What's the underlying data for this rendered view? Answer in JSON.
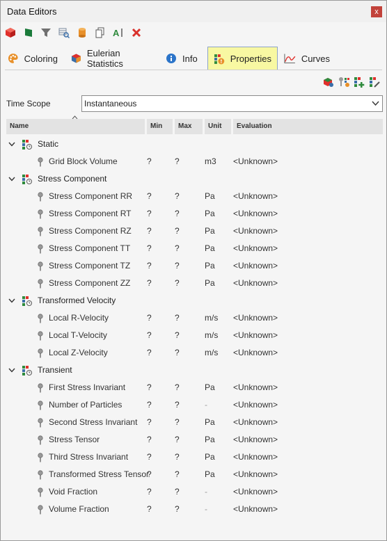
{
  "window": {
    "title": "Data Editors",
    "close_glyph": "x"
  },
  "toolbar": [
    {
      "name": "red-cube-icon",
      "color": "#e0302c"
    },
    {
      "name": "green-flag-icon",
      "color": "#1a7a3a"
    },
    {
      "name": "filter-icon",
      "color": "#707070"
    },
    {
      "name": "search-grid-icon",
      "color": "#5a7fa8"
    },
    {
      "name": "cylinder-icon",
      "color": "#e8902a"
    },
    {
      "name": "copy-icon",
      "color": "#555555"
    },
    {
      "name": "text-cursor-icon",
      "color": "#2e8a3c"
    },
    {
      "name": "delete-icon",
      "color": "#d9312b"
    }
  ],
  "tabs": [
    {
      "label": "Coloring",
      "icon": "palette-icon",
      "active": false
    },
    {
      "label": "Eulerian Statistics",
      "icon": "statistics-cube-icon",
      "active": false
    },
    {
      "label": "Info",
      "icon": "info-icon",
      "active": false
    },
    {
      "label": "Properties",
      "icon": "properties-icon",
      "active": true
    },
    {
      "label": "Curves",
      "icon": "curve-chart-icon",
      "active": false
    }
  ],
  "time_scope": {
    "label": "Time Scope",
    "value": "Instantaneous"
  },
  "columns": {
    "name": "Name",
    "min": "Min",
    "max": "Max",
    "unit": "Unit",
    "evaluation": "Evaluation"
  },
  "groups": [
    {
      "label": "Static",
      "rows": [
        {
          "name": "Grid Block Volume",
          "min": "?",
          "max": "?",
          "unit": "m3",
          "evaluation": "<Unknown>"
        }
      ]
    },
    {
      "label": "Stress Component",
      "rows": [
        {
          "name": "Stress Component RR",
          "min": "?",
          "max": "?",
          "unit": "Pa",
          "evaluation": "<Unknown>"
        },
        {
          "name": "Stress Component RT",
          "min": "?",
          "max": "?",
          "unit": "Pa",
          "evaluation": "<Unknown>"
        },
        {
          "name": "Stress Component RZ",
          "min": "?",
          "max": "?",
          "unit": "Pa",
          "evaluation": "<Unknown>"
        },
        {
          "name": "Stress Component TT",
          "min": "?",
          "max": "?",
          "unit": "Pa",
          "evaluation": "<Unknown>"
        },
        {
          "name": "Stress Component TZ",
          "min": "?",
          "max": "?",
          "unit": "Pa",
          "evaluation": "<Unknown>"
        },
        {
          "name": "Stress Component ZZ",
          "min": "?",
          "max": "?",
          "unit": "Pa",
          "evaluation": "<Unknown>"
        }
      ]
    },
    {
      "label": "Transformed Velocity",
      "rows": [
        {
          "name": "Local R-Velocity",
          "min": "?",
          "max": "?",
          "unit": "m/s",
          "evaluation": "<Unknown>"
        },
        {
          "name": "Local T-Velocity",
          "min": "?",
          "max": "?",
          "unit": "m/s",
          "evaluation": "<Unknown>"
        },
        {
          "name": "Local Z-Velocity",
          "min": "?",
          "max": "?",
          "unit": "m/s",
          "evaluation": "<Unknown>"
        }
      ]
    },
    {
      "label": "Transient",
      "rows": [
        {
          "name": "First Stress Invariant",
          "min": "?",
          "max": "?",
          "unit": "Pa",
          "evaluation": "<Unknown>"
        },
        {
          "name": "Number of Particles",
          "min": "?",
          "max": "?",
          "unit": "-",
          "evaluation": "<Unknown>"
        },
        {
          "name": "Second Stress Invariant",
          "min": "?",
          "max": "?",
          "unit": "Pa",
          "evaluation": "<Unknown>"
        },
        {
          "name": "Stress Tensor",
          "min": "?",
          "max": "?",
          "unit": "Pa",
          "evaluation": "<Unknown>"
        },
        {
          "name": "Third Stress Invariant",
          "min": "?",
          "max": "?",
          "unit": "Pa",
          "evaluation": "<Unknown>"
        },
        {
          "name": "Transformed Stress Tensor",
          "min": "?",
          "max": "?",
          "unit": "Pa",
          "evaluation": "<Unknown>"
        },
        {
          "name": "Void Fraction",
          "min": "?",
          "max": "?",
          "unit": "-",
          "evaluation": "<Unknown>"
        },
        {
          "name": "Volume Fraction",
          "min": "?",
          "max": "?",
          "unit": "-",
          "evaluation": "<Unknown>"
        }
      ]
    }
  ],
  "colors": {
    "active_tab": "#f8f8a2",
    "header_bg": "#e3e3e3"
  }
}
